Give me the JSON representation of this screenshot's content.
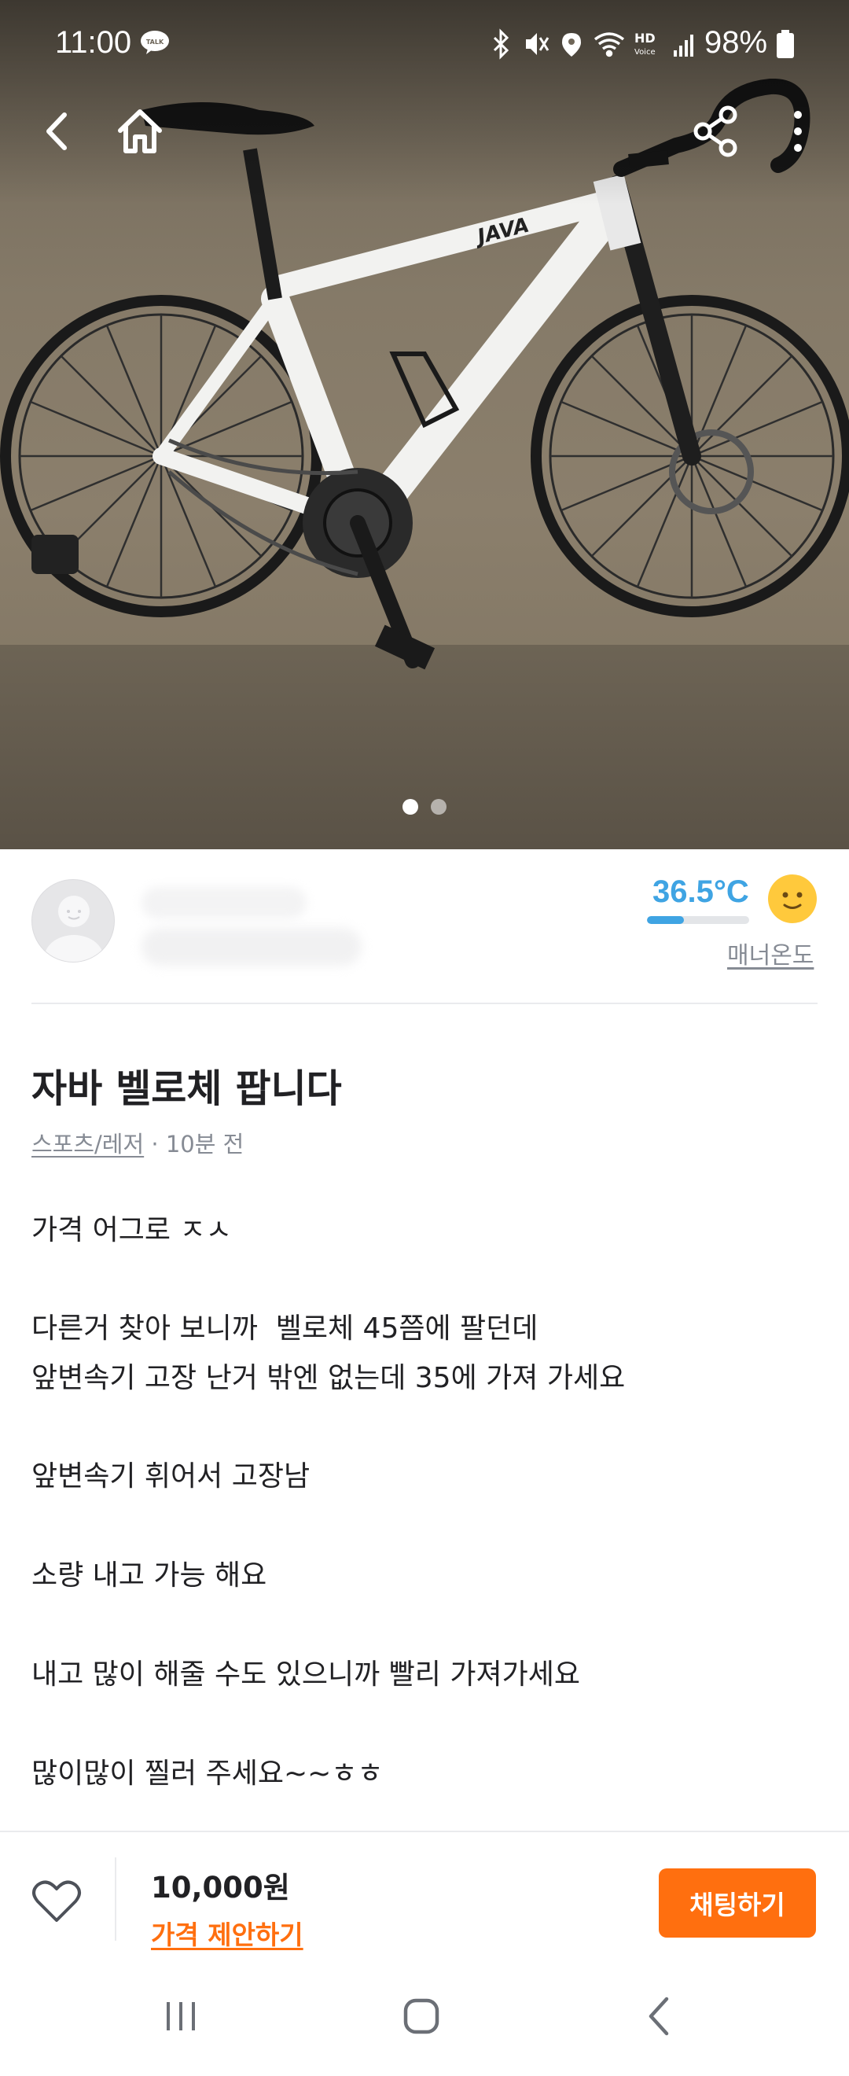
{
  "status_bar": {
    "time": "11:00",
    "battery": "98%",
    "icons": [
      "talk-icon",
      "bluetooth-icon",
      "mute-icon",
      "location-icon",
      "wifi-icon",
      "hd-voice-icon",
      "signal-icon",
      "battery-icon"
    ],
    "hd_label": "HD",
    "voice_label": "Voice",
    "talk_label": "TALK"
  },
  "hero": {
    "brand": "JAVA",
    "slide_count": 2,
    "current_slide": 1
  },
  "seller": {
    "manner_temperature": "36.5°C",
    "manner_level": 0.36,
    "manner_label": "매너온도",
    "temp_color": "#3fa4e3"
  },
  "post": {
    "title": "자바 벨로체 팝니다",
    "category": "스포츠/레저",
    "time_ago": " · 10분 전",
    "body": [
      "가격 어그로 ㅈㅅ",
      "다른거 찾아 보니까  벨로체 45쯤에 팔던데",
      "앞변속기 고장 난거 밖엔 없는데 35에 가져 가세요",
      "앞변속기 휘어서 고장남",
      "소량 내고 가능 해요",
      "내고 많이 해줄 수도 있으니까 빨리 가져가세요",
      "많이많이 찔러 주세요~~ㅎㅎ"
    ]
  },
  "bottom_bar": {
    "price": "10,000원",
    "offer_label": "가격 제안하기",
    "chat_label": "채팅하기",
    "accent": "#ff6f0f"
  }
}
